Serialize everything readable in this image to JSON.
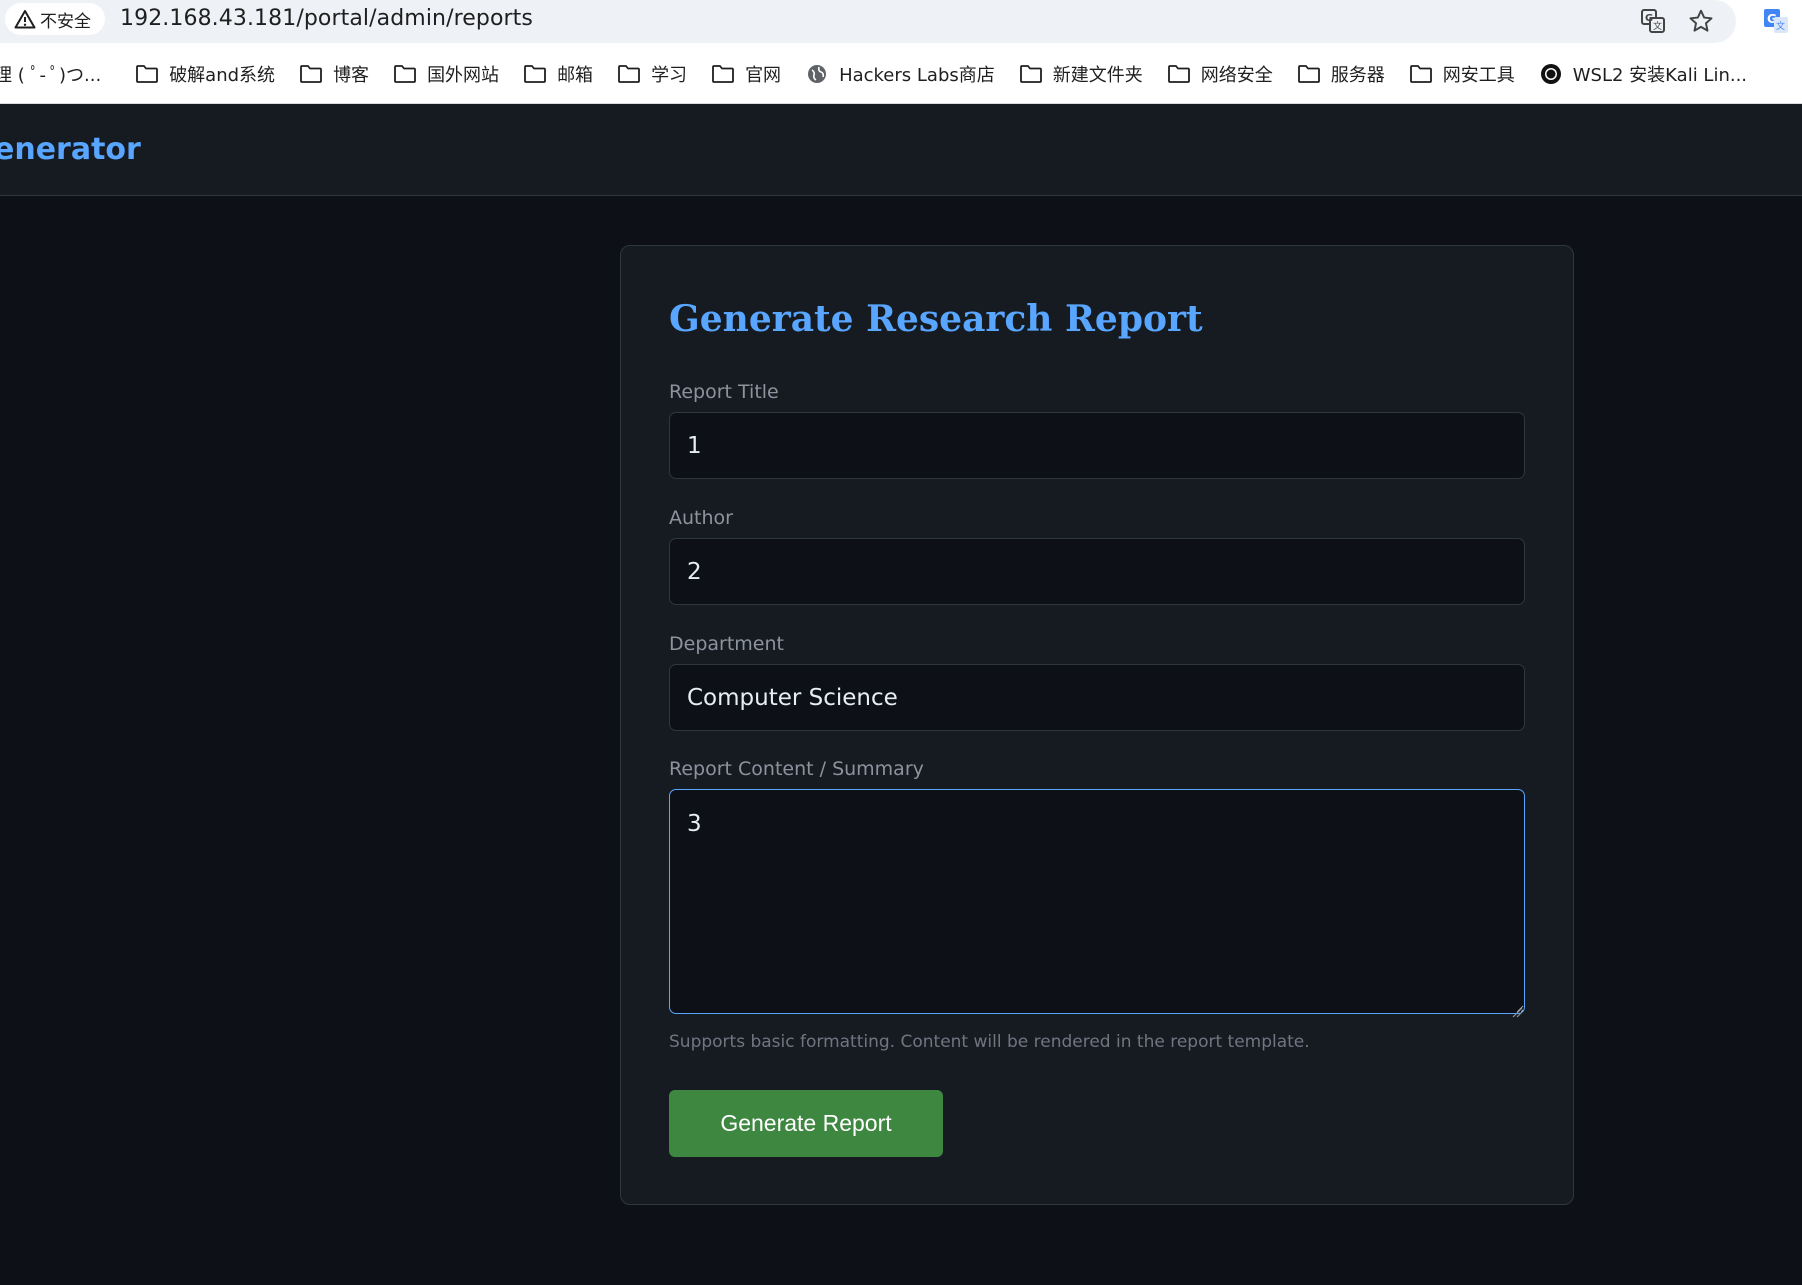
{
  "browser": {
    "security_label": "不安全",
    "url": "192.168.43.181/portal/admin/reports",
    "icons": [
      "warning-icon",
      "translate-icon",
      "star-icon",
      "google-translate-extension-icon"
    ],
    "bookmarks": [
      {
        "label": "理 ( ﾟ- ﾟ)つ...",
        "icon": "none"
      },
      {
        "label": "破解and系统",
        "icon": "folder-icon"
      },
      {
        "label": "博客",
        "icon": "folder-icon"
      },
      {
        "label": "国外网站",
        "icon": "folder-icon"
      },
      {
        "label": "邮箱",
        "icon": "folder-icon"
      },
      {
        "label": "学习",
        "icon": "folder-icon"
      },
      {
        "label": "官网",
        "icon": "folder-icon"
      },
      {
        "label": "Hackers Labs商店",
        "icon": "globe-icon"
      },
      {
        "label": "新建文件夹",
        "icon": "folder-icon"
      },
      {
        "label": "网络安全",
        "icon": "folder-icon"
      },
      {
        "label": "服务器",
        "icon": "folder-icon"
      },
      {
        "label": "网安工具",
        "icon": "folder-icon"
      },
      {
        "label": "WSL2 安装Kali Lin...",
        "icon": "github-icon"
      }
    ]
  },
  "app": {
    "brand": "enerator"
  },
  "form": {
    "title": "Generate Research Report",
    "report_title": {
      "label": "Report Title",
      "value": "1"
    },
    "author": {
      "label": "Author",
      "value": "2"
    },
    "department": {
      "label": "Department",
      "value": "Computer Science"
    },
    "content": {
      "label": "Report Content / Summary",
      "value": "3"
    },
    "hint": "Supports basic formatting. Content will be rendered in the report template.",
    "submit_label": "Generate Report"
  },
  "colors": {
    "page_bg": "#0d1117",
    "card_bg": "#161b22",
    "accent": "#58a6ff",
    "button": "#3e8741"
  }
}
